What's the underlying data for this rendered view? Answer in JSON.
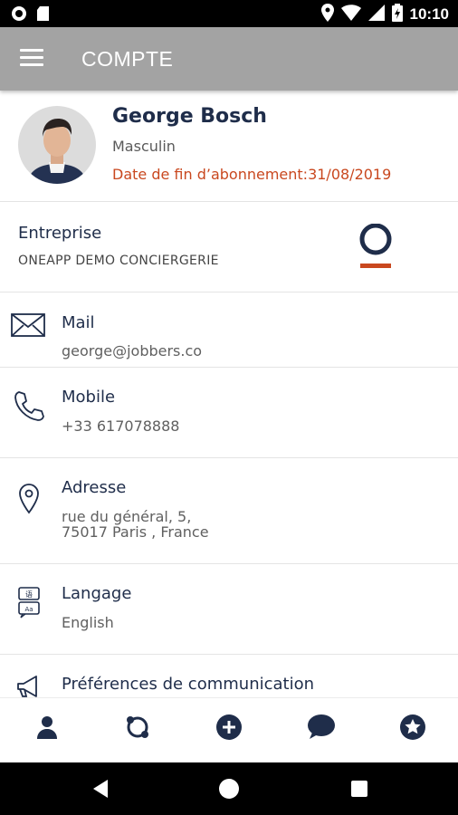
{
  "status_bar": {
    "time": "10:10",
    "left_icons": [
      "record-icon",
      "sd-card-icon"
    ],
    "right_icons": [
      "location-icon",
      "wifi-icon",
      "signal-icon",
      "battery-icon"
    ]
  },
  "app_bar": {
    "title": "COMPTE",
    "menu_icon": "hamburger-menu-icon"
  },
  "profile": {
    "name": "George Bosch",
    "gender": "Masculin",
    "subscription": "Date de fin d’abonnement:31/08/2019",
    "subscription_color": "#c9481f"
  },
  "company": {
    "label": "Entreprise",
    "value": "ONEAPP DEMO CONCIERGERIE",
    "logo_colors": [
      "#1f2d4a",
      "#c9481f"
    ]
  },
  "fields": [
    {
      "icon": "mail-icon",
      "label": "Mail",
      "value": "george@jobbers.co"
    },
    {
      "icon": "phone-icon",
      "label": "Mobile",
      "value": "+33 617078888"
    },
    {
      "icon": "location-pin-icon",
      "label": "Adresse",
      "value_lines": [
        "rue du général, 5,",
        "75017 Paris , France"
      ]
    },
    {
      "icon": "language-icon",
      "label": "Langage",
      "value": "English"
    },
    {
      "icon": "megaphone-icon",
      "label": "Préférences de communication"
    }
  ],
  "bottom_nav": [
    {
      "icon": "person-icon",
      "active": true
    },
    {
      "icon": "refresh-icon",
      "active": false
    },
    {
      "icon": "add-circle-icon",
      "active": false
    },
    {
      "icon": "chat-bubble-icon",
      "active": false
    },
    {
      "icon": "star-circle-icon",
      "active": false
    }
  ],
  "system_nav": [
    "back-icon",
    "home-icon",
    "recents-icon"
  ],
  "colors": {
    "primary": "#1f2d4a",
    "accent": "#c9481f",
    "app_bar": "#a3a3a3"
  }
}
